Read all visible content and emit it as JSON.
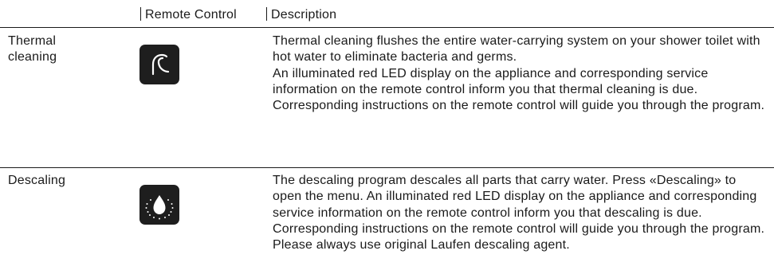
{
  "table": {
    "headers": {
      "remote_control": "Remote Control",
      "description": "Description"
    },
    "rows": [
      {
        "title": "Thermal\ncleaning",
        "icon": "thermal-cleaning-icon",
        "description": [
          "Thermal cleaning flushes the entire water-carrying system on your shower toilet with hot water to eliminate bacteria and germs.",
          "An illuminated red LED display on the appliance and corresponding service information on the remote control inform you that thermal cleaning is due. Corresponding instructions on the remote control will guide you through the program."
        ]
      },
      {
        "title": "Descaling",
        "icon": "descaling-icon",
        "description": [
          "The descaling program descales all parts that carry water. Press «Descaling» to open the menu. An illuminated red LED display on the appliance and corresponding service information on the remote control inform you that descaling is due. Corresponding instructions on the remote control will guide you through the program. Please always use original Laufen descaling agent."
        ]
      }
    ]
  },
  "colors": {
    "text": "#1a1a1a",
    "icon_tile": "#1e1e1e",
    "icon_glyph": "#ffffff"
  }
}
